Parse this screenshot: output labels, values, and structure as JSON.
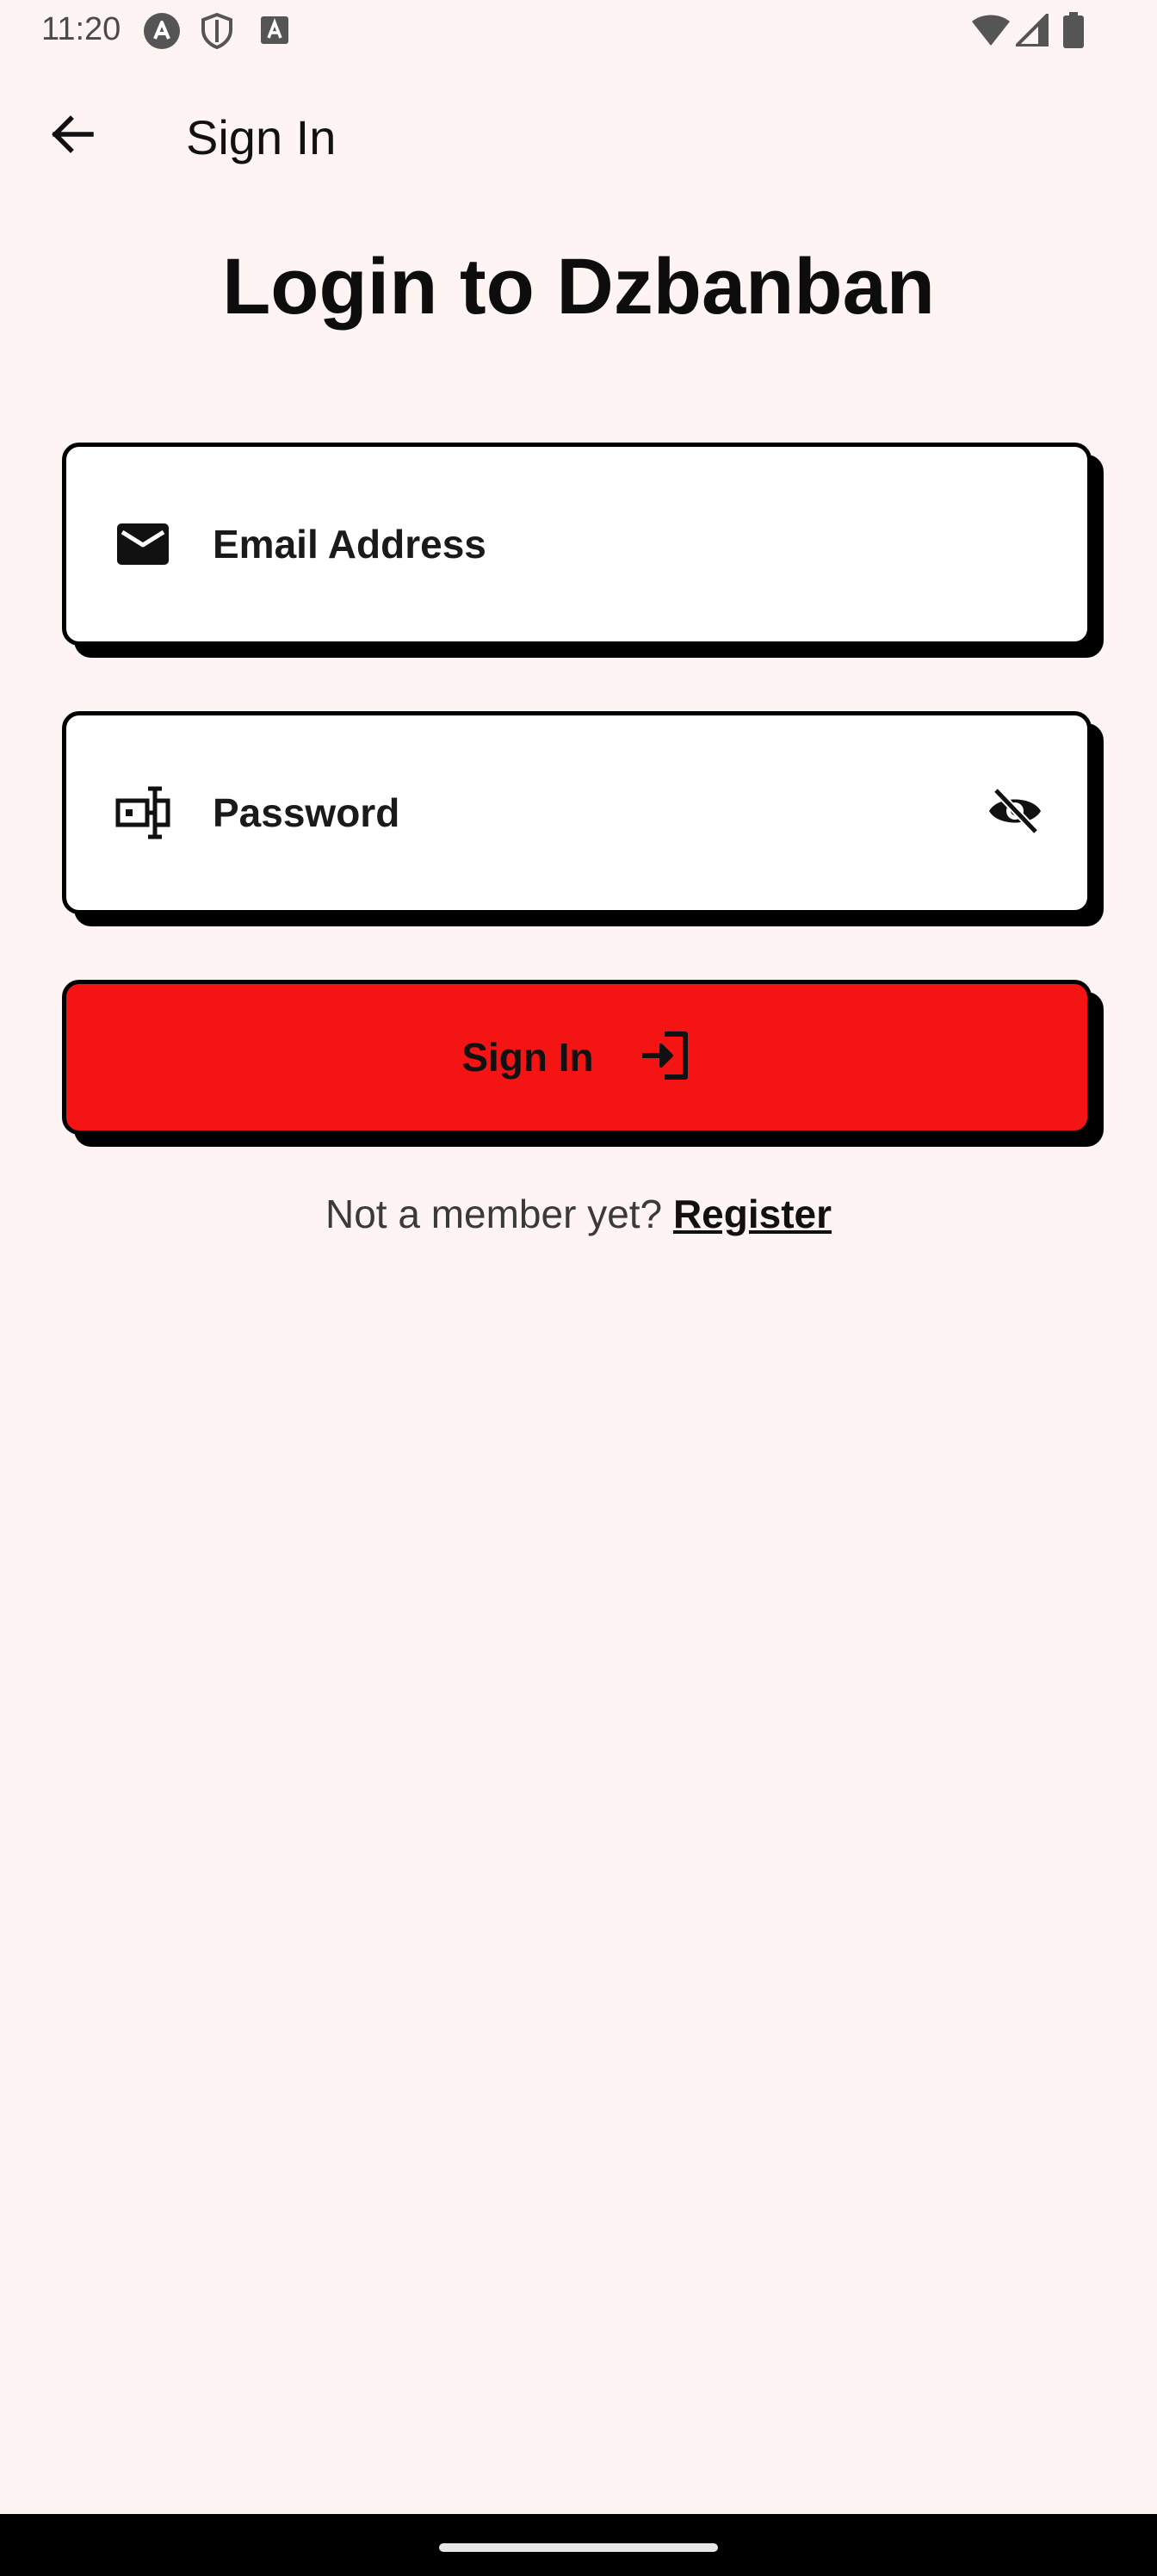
{
  "status_bar": {
    "time": "11:20",
    "icons": [
      "assistant-icon",
      "shield-icon",
      "text-a-icon",
      "wifi-icon",
      "signal-icon",
      "battery-icon"
    ]
  },
  "app_bar": {
    "back_icon": "arrow-back-icon",
    "title": "Sign In"
  },
  "heading": "Login to Dzbanban",
  "email_field": {
    "icon": "mail-icon",
    "placeholder": "Email Address"
  },
  "password_field": {
    "icon": "password-key-icon",
    "placeholder": "Password",
    "visibility_icon": "eye-off-icon"
  },
  "sign_in_button": {
    "label": "Sign In",
    "icon": "login-icon",
    "color": "#f51414"
  },
  "register_prompt": {
    "text": "Not a member yet?",
    "link": "Register"
  },
  "colors": {
    "background": "#fff4f4",
    "accent": "#f51414",
    "border": "#000000"
  }
}
